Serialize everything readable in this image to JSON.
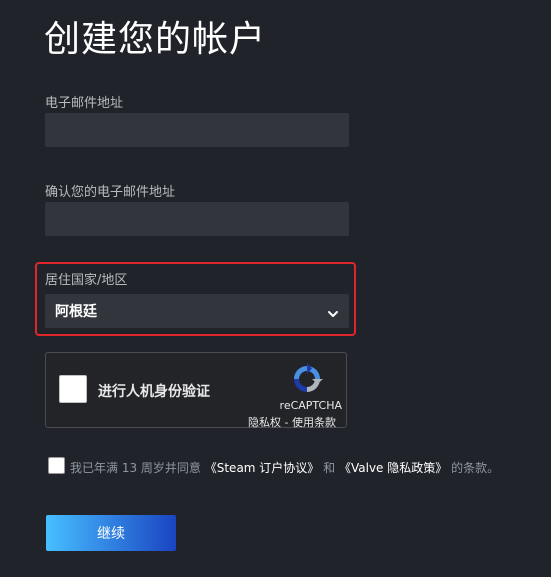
{
  "page": {
    "title": "创建您的帐户"
  },
  "email": {
    "label": "电子邮件地址",
    "value": ""
  },
  "confirm_email": {
    "label": "确认您的电子邮件地址",
    "value": ""
  },
  "country": {
    "label": "居住国家/地区",
    "selected": "阿根廷",
    "highlight_color": "#e0262a"
  },
  "captcha": {
    "prompt": "进行人机身份验证",
    "brand": "reCAPTCHA",
    "links": "隐私权 - 使用条款"
  },
  "agreement": {
    "prefix": "我已年满 13 周岁并同意",
    "subscriber_link": "《Steam 订户协议》",
    "connector": "和",
    "privacy_link": "《Valve 隐私政策》",
    "suffix": "的条款。"
  },
  "continue_button": {
    "label": "继续"
  },
  "colors": {
    "background": "#202329",
    "input_background": "#32353c",
    "button_gradient_start": "#47bfff",
    "button_gradient_end": "#1a44c2"
  }
}
